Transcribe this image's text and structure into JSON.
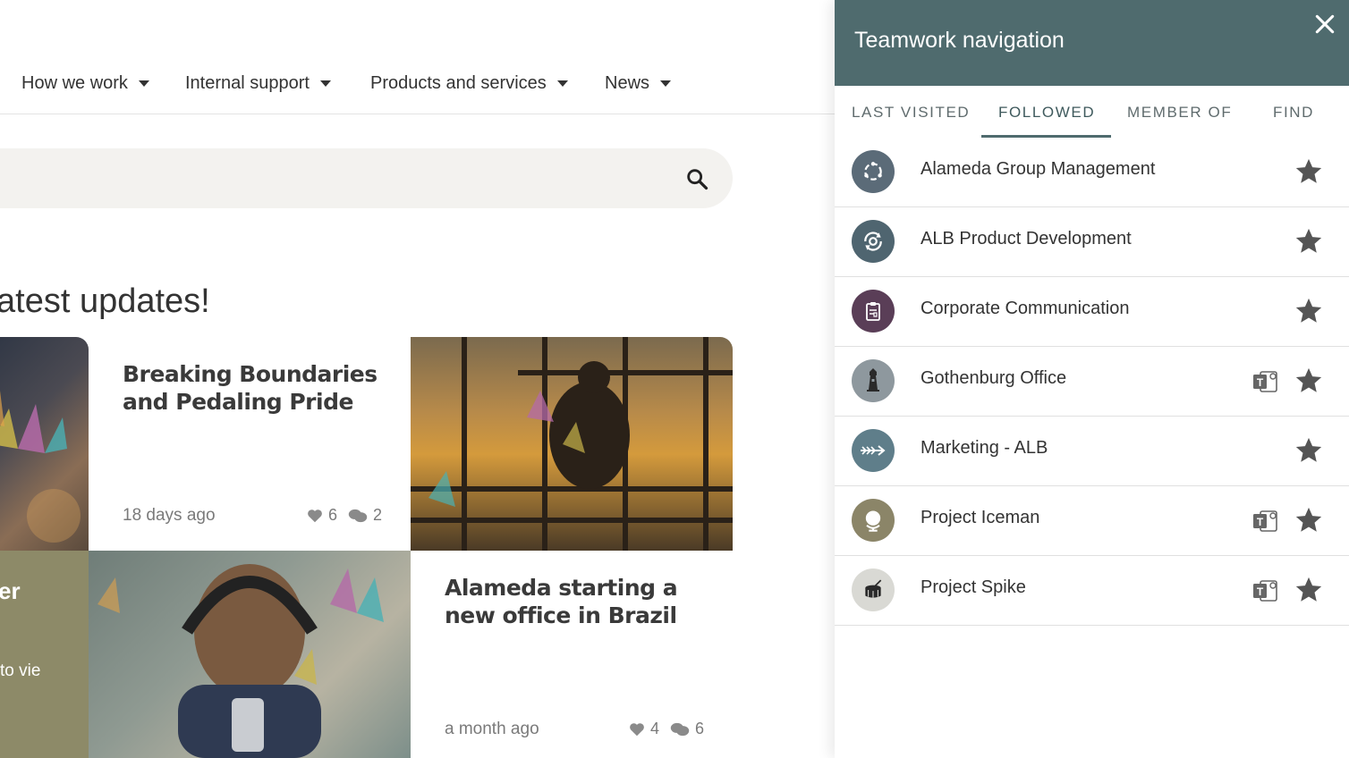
{
  "nav": {
    "items": [
      "How we work",
      "Internal support",
      "Products and services",
      "News"
    ]
  },
  "main": {
    "section_title": "atest updates!",
    "cards": [
      {
        "title": "Breaking Boundaries and Pedaling Pride",
        "date": "18 days ago",
        "likes": "6",
        "comments": "2"
      },
      {
        "title": "Alameda starting a new office in Brazil",
        "date": "a month ago",
        "likes": "4",
        "comments": "6"
      }
    ],
    "olive_tile": {
      "title_fragment": "er",
      "text_fragment": "to vie"
    }
  },
  "panel": {
    "title": "Teamwork navigation",
    "tabs": [
      "LAST VISITED",
      "FOLLOWED",
      "MEMBER OF",
      "FIND"
    ],
    "active_tab": "FOLLOWED",
    "items": [
      {
        "label": "Alameda Group Management",
        "icon": "cycle-icon",
        "color": "#5b6b78",
        "teams": false
      },
      {
        "label": "ALB Product Development",
        "icon": "gear-cycle-icon",
        "color": "#4f6570",
        "teams": false
      },
      {
        "label": "Corporate Communication",
        "icon": "clipboard-icon",
        "color": "#5a3e57",
        "teams": false
      },
      {
        "label": "Gothenburg Office",
        "icon": "lighthouse-icon",
        "color": "#8e989e",
        "teams": true
      },
      {
        "label": "Marketing - ALB",
        "icon": "arrow-icon",
        "color": "#5f7e8a",
        "teams": false
      },
      {
        "label": "Project Iceman",
        "icon": "globe-icon",
        "color": "#8b8568",
        "teams": true
      },
      {
        "label": "Project Spike",
        "icon": "drum-icon",
        "color": "#d9d9d4",
        "teams": true
      }
    ]
  },
  "colors": {
    "panel_header": "#4f6b6e",
    "star": "#555555",
    "olive": "#8d8a68"
  }
}
